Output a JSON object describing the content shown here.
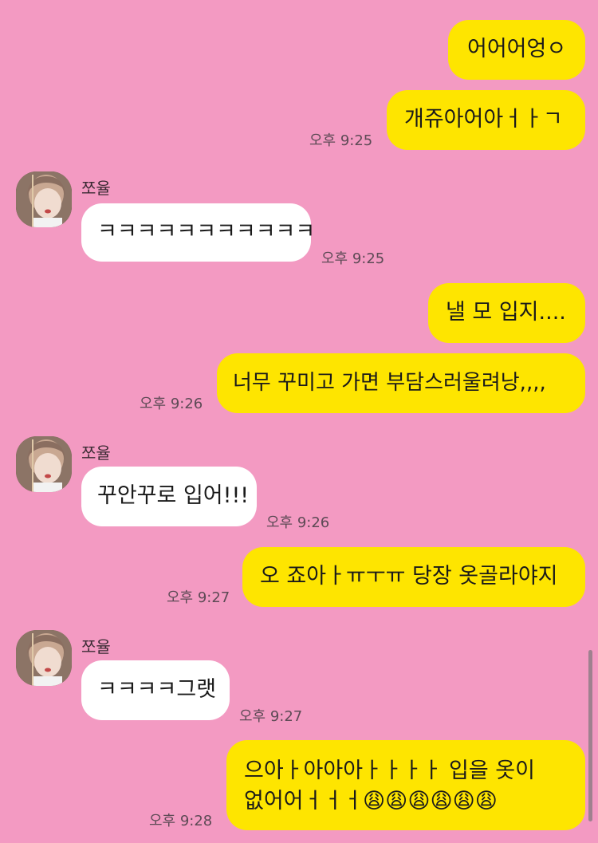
{
  "messages": [
    {
      "id": "m1",
      "sender": "me",
      "text": "어어어엉ㅇ"
    },
    {
      "id": "m2",
      "sender": "me",
      "text": "개쥬아어아ㅓㅏㄱ",
      "time": "오후 9:25"
    },
    {
      "id": "m3",
      "sender": "other",
      "name": "쪼율",
      "text": "ㅋㅋㅋㅋㅋㅋㅋㅋㅋㅋㅋ",
      "time": "오후 9:25"
    },
    {
      "id": "m4",
      "sender": "me",
      "text": "낼 모 입지...."
    },
    {
      "id": "m5",
      "sender": "me",
      "text": "너무 꾸미고 가면 부담스러울려낭,,,,",
      "time": "오후 9:26"
    },
    {
      "id": "m6",
      "sender": "other",
      "name": "쪼율",
      "text": "꾸안꾸로 입어!!!",
      "time": "오후 9:26"
    },
    {
      "id": "m7",
      "sender": "me",
      "text": "오 죠아ㅏㅠㅜㅠ 당장 옷골라야지",
      "time": "오후 9:27"
    },
    {
      "id": "m8",
      "sender": "other",
      "name": "쪼율",
      "text": "ㅋㅋㅋㅋ그랫",
      "time": "오후 9:27"
    },
    {
      "id": "m9",
      "sender": "me",
      "line1": "으아ㅏ아아아ㅏㅏㅏㅏ 입을 옷이",
      "line2": "없어어ㅓㅓㅓ😩😩😩😩😩😩",
      "time": "오후 9:28"
    }
  ],
  "icons": {
    "avatar": "profile-photo",
    "scrollbar": "scroll-indicator"
  },
  "colors": {
    "background": "#f39ac2",
    "my_bubble": "#fee500",
    "their_bubble": "#ffffff"
  }
}
